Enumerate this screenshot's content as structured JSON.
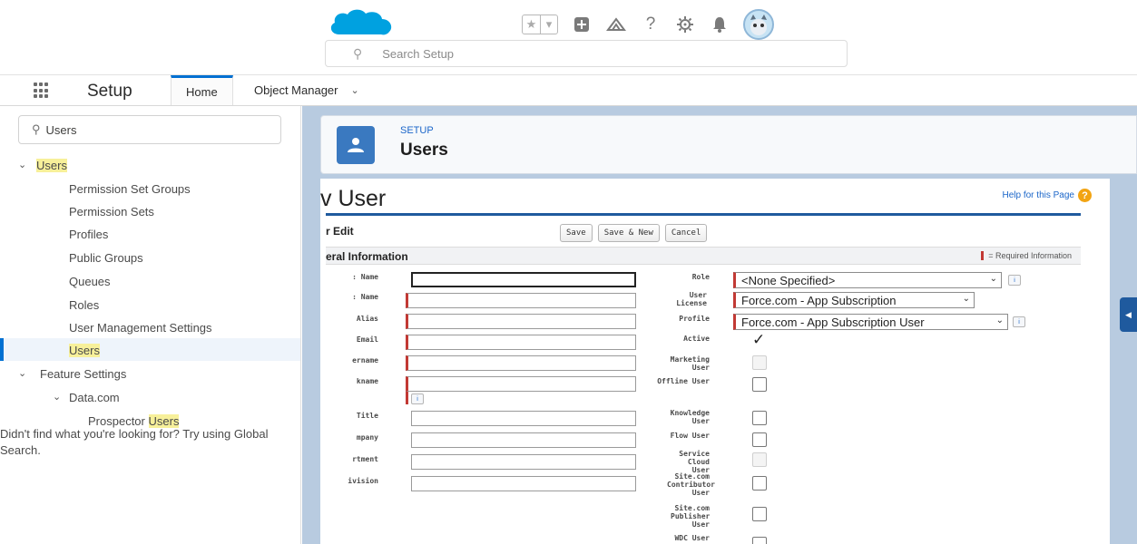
{
  "header": {
    "search_placeholder": "Search Setup",
    "brand_color": "#00a1e0",
    "icons": [
      "star-icon",
      "chevron-down-icon",
      "add-icon",
      "trailhead-icon",
      "help-icon",
      "gear-icon",
      "bell-icon",
      "avatar"
    ]
  },
  "nav": {
    "app_name": "Setup",
    "tabs": [
      {
        "label": "Home",
        "active": true
      },
      {
        "label": "Object Manager",
        "active": false
      }
    ]
  },
  "sidebar": {
    "quickfind_value": "Users",
    "section_users": "Users",
    "items": [
      {
        "label": "Permission Set Groups"
      },
      {
        "label": "Permission Sets"
      },
      {
        "label": "Profiles"
      },
      {
        "label": "Public Groups"
      },
      {
        "label": "Queues"
      },
      {
        "label": "Roles"
      },
      {
        "label": "User Management Settings"
      },
      {
        "label": "Users"
      }
    ],
    "feature_settings": "Feature Settings",
    "datacom": "Data.com",
    "prospector_prefix": "Prospector",
    "prospector_highlight": "Users",
    "help_text": "Didn't find what you're looking for? Try using Global Search."
  },
  "page_header": {
    "eyebrow": "SETUP",
    "title": "Users"
  },
  "form": {
    "title": "v User",
    "help_link": "Help for this Page",
    "panel_title": "r Edit",
    "buttons": {
      "save": "Save",
      "save_new": "Save & New",
      "cancel": "Cancel"
    },
    "section_title": "eral Information",
    "required_legend": "= Required Information",
    "left_labels": {
      "first_name": ": Name",
      "last_name": ": Name",
      "alias": "Alias",
      "email": "Email",
      "username": "ername",
      "nickname": "kname",
      "title": "Title",
      "company": "mpany",
      "department": "rtment",
      "division": "ivision"
    },
    "right_labels": {
      "role": "Role",
      "user_license": "User License",
      "profile": "Profile",
      "active": "Active",
      "marketing_user": "Marketing User",
      "offline_user": "Offline User",
      "knowledge_user": "Knowledge User",
      "flow_user": "Flow User",
      "service_cloud_user": "Service Cloud User",
      "site_contributor": "Site.com Contributor User",
      "site_publisher": "Site.com Publisher User",
      "wdc_user": "WDC User"
    },
    "role_value": "<None Specified>",
    "license_value": "Force.com - App Subscription",
    "profile_value": "Force.com - App Subscription User",
    "info_icon": "i",
    "active_checked": true
  }
}
